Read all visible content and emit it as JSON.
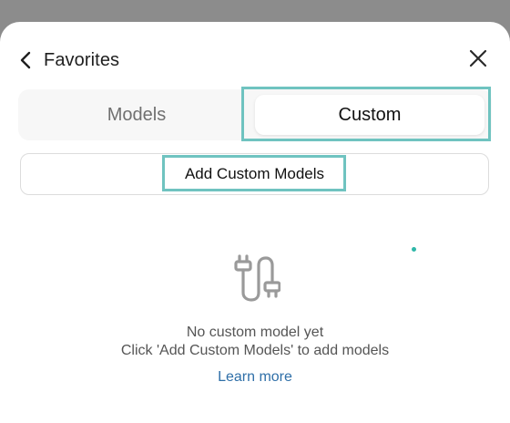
{
  "header": {
    "back_label": "Favorites",
    "back_icon": "chevron-left-icon",
    "close_icon": "close-icon"
  },
  "tabs": [
    {
      "label": "Models",
      "selected": false
    },
    {
      "label": "Custom",
      "selected": true
    }
  ],
  "add_button": {
    "label": "Add Custom Models"
  },
  "empty_state": {
    "icon": "plug-connector-icon",
    "title": "No custom model yet",
    "hint": "Click 'Add Custom Models' to add models",
    "link_label": "Learn more"
  },
  "colors": {
    "highlight": "#6fc3c0",
    "link": "#2f6fa8",
    "accent_dot": "#2fb7a8",
    "backdrop": "#8c8c8c"
  }
}
